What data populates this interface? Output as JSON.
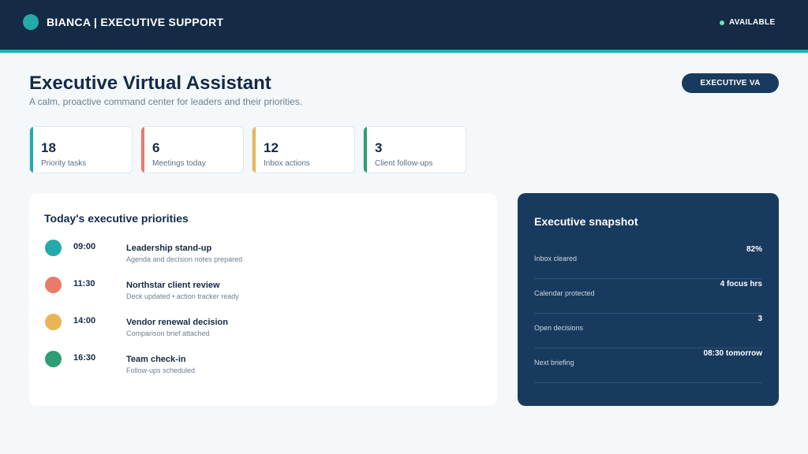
{
  "header": {
    "title": "BIANCA | EXECUTIVE SUPPORT",
    "status": "AVAILABLE",
    "accent": "#2aaeb0"
  },
  "page": {
    "title": "Executive Virtual Assistant",
    "subtitle": "A calm, proactive command center for leaders and their priorities.",
    "role_badge": "EXECUTIVE VA"
  },
  "stats": [
    {
      "value": "18",
      "label": "Priority tasks",
      "color": "#24aaa9"
    },
    {
      "value": "6",
      "label": "Meetings today",
      "color": "#ea7b6a"
    },
    {
      "value": "12",
      "label": "Inbox actions",
      "color": "#e8b657"
    },
    {
      "value": "3",
      "label": "Client follow-ups",
      "color": "#2e9e74"
    }
  ],
  "priorities": {
    "title": "Today's executive priorities",
    "items": [
      {
        "time": "09:00",
        "title": "Leadership stand-up",
        "note": "Agenda and decision notes prepared",
        "color": "#24aaa9"
      },
      {
        "time": "11:30",
        "title": "Northstar client review",
        "note": "Deck updated • action tracker ready",
        "color": "#ea7b6a"
      },
      {
        "time": "14:00",
        "title": "Vendor renewal decision",
        "note": "Comparison brief attached",
        "color": "#e8b657"
      },
      {
        "time": "16:30",
        "title": "Team check-in",
        "note": "Follow-ups scheduled",
        "color": "#2e9e74"
      }
    ]
  },
  "snapshot": {
    "title": "Executive snapshot",
    "rows": [
      {
        "label": "Inbox cleared",
        "value": "82%"
      },
      {
        "label": "Calendar protected",
        "value": "4 focus hrs"
      },
      {
        "label": "Open decisions",
        "value": "3"
      },
      {
        "label": "Next briefing",
        "value": "08:30 tomorrow"
      }
    ]
  }
}
